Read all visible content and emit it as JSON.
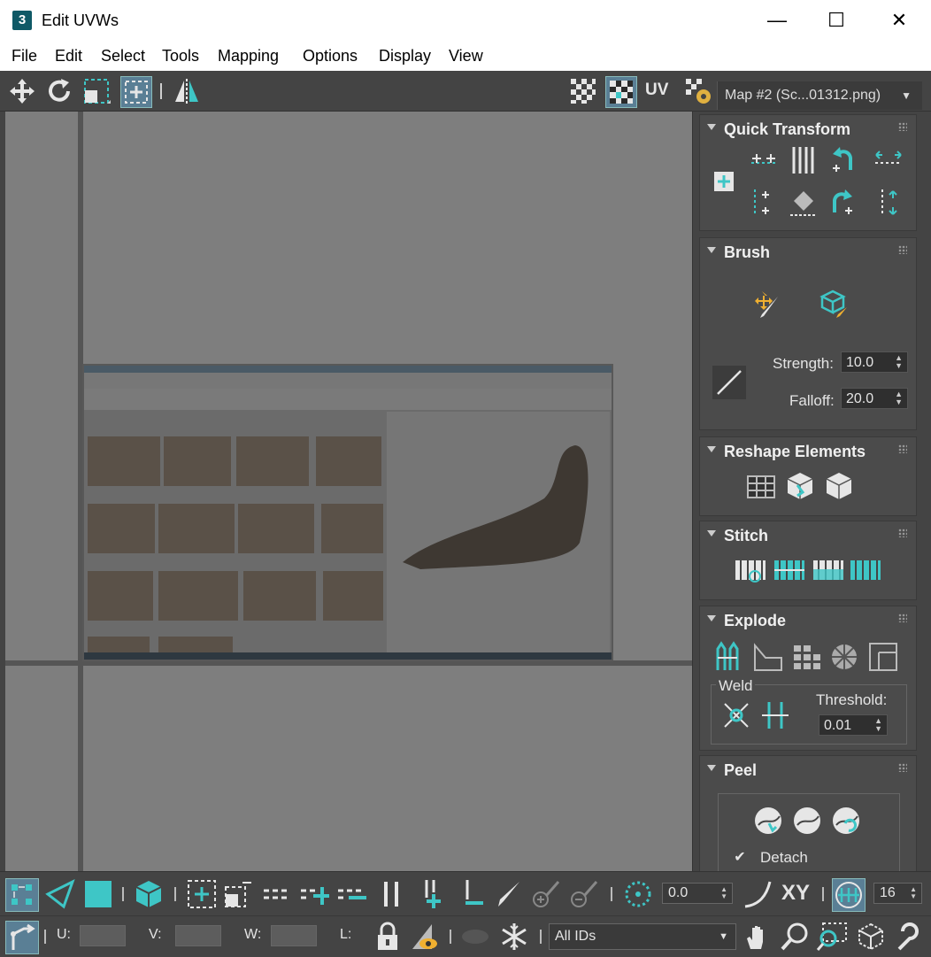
{
  "window": {
    "title": "Edit UVWs",
    "app_icon": "3",
    "minimize": "—",
    "maximize": "☐",
    "close": "✕"
  },
  "menu": [
    "File",
    "Edit",
    "Select",
    "Tools",
    "Mapping",
    "Options",
    "Display",
    "View"
  ],
  "toolbar": {
    "uv_label": "UV",
    "map_selector": "Map #2 (Sc...01312.png)",
    "dropdown_arrow": "▼"
  },
  "rollouts": {
    "quick_transform": {
      "title": "Quick Transform"
    },
    "brush": {
      "title": "Brush",
      "strength_label": "Strength:",
      "strength_value": "10.0",
      "falloff_label": "Falloff:",
      "falloff_value": "20.0"
    },
    "reshape": {
      "title": "Reshape Elements"
    },
    "stitch": {
      "title": "Stitch"
    },
    "explode": {
      "title": "Explode",
      "weld_label": "Weld",
      "threshold_label": "Threshold:",
      "threshold_value": "0.01"
    },
    "peel": {
      "title": "Peel",
      "detach_label": "Detach",
      "detach_checked": true
    }
  },
  "bottom": {
    "angle_value": "0.0",
    "xy_label": "XY",
    "grid_value": "16",
    "u_label": "U:",
    "v_label": "V:",
    "w_label": "W:",
    "l_label": "L:",
    "ids_dropdown": "All IDs"
  },
  "colors": {
    "accent": "#3ec6c6",
    "panel": "#444444",
    "viewport": "#7e7e7e"
  }
}
